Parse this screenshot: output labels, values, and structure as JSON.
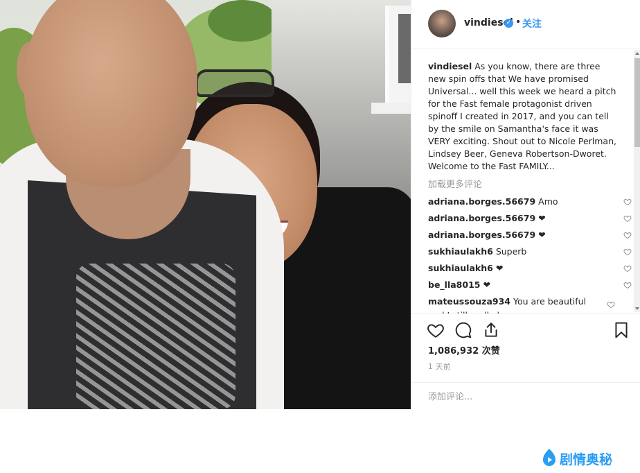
{
  "header": {
    "username": "vindiesel",
    "separator": "•",
    "follow_label": "关注"
  },
  "caption": {
    "username": "vindiesel",
    "text": "As you know, there are three new spin offs that We have promised Universal... well this week we heard a pitch for the Fast female protagonist driven spinoff I created in 2017, and you can tell by the smile on Samantha's face it was VERY exciting. Shout out to Nicole Perlman, Lindsey Beer, Geneva Robertson-Dworet. Welcome to the Fast FAMILY..."
  },
  "load_more_label": "加载更多评论",
  "comments": [
    {
      "user": "adriana.borges.56679",
      "text": "Amo"
    },
    {
      "user": "adriana.borges.56679",
      "text": "❤"
    },
    {
      "user": "adriana.borges.56679",
      "text": "❤"
    },
    {
      "user": "sukhiaulakh6",
      "text": "Superb"
    },
    {
      "user": "sukhiaulakh6",
      "text": "❤"
    },
    {
      "user": "be_lla8015",
      "text": "❤"
    },
    {
      "user": "mateussouza934",
      "text": "You are beautiful and I still really love you"
    }
  ],
  "likes": "1,086,932 次赞",
  "time": "1 天前",
  "add_comment": {
    "placeholder": "添加评论..."
  },
  "watermark": {
    "text": "剧情奥秘"
  },
  "icons": [
    "heart-icon",
    "comment-icon",
    "share-icon",
    "bookmark-icon",
    "verified-badge-icon"
  ],
  "colors": {
    "accent": "#3897f0",
    "watermark": "#2a9df4",
    "muted": "#999999"
  }
}
